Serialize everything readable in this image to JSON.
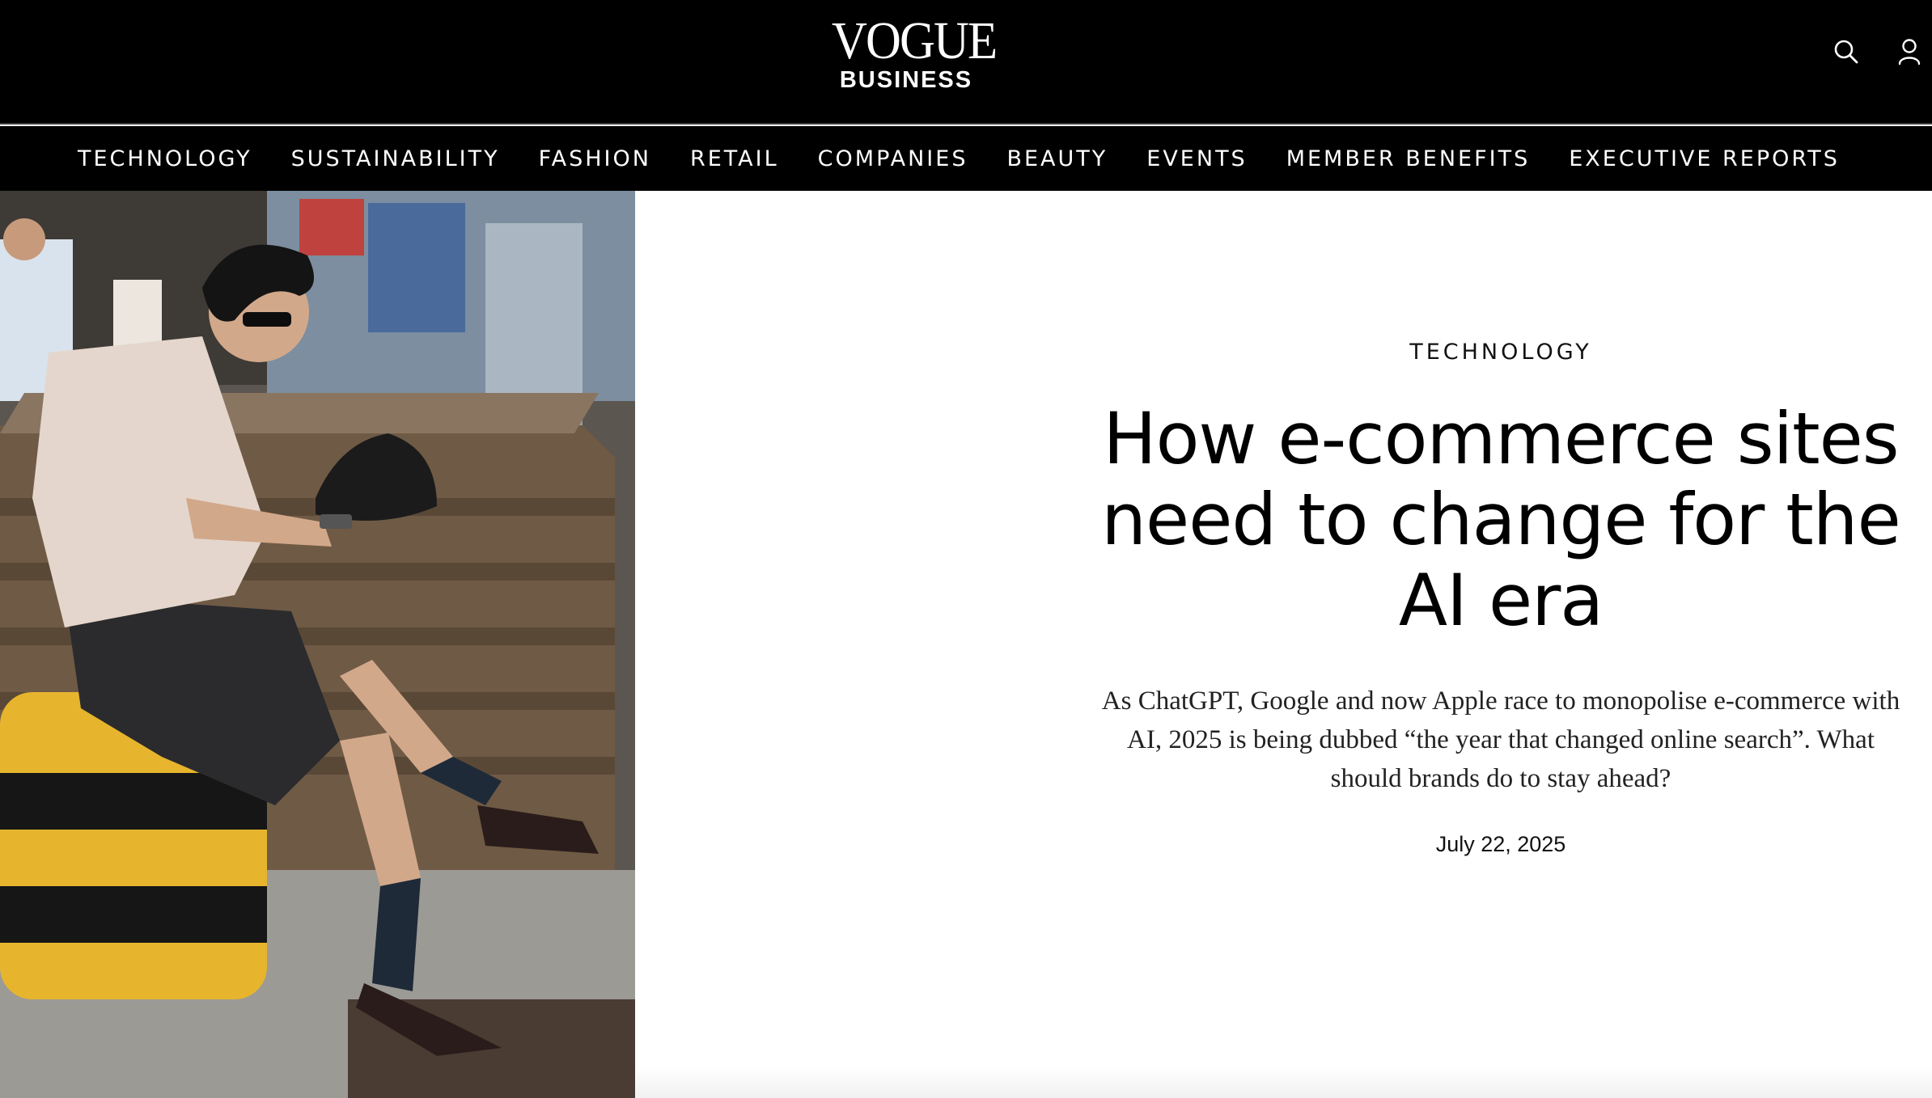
{
  "header": {
    "logo_main": "VOGUE",
    "logo_sub": "BUSINESS",
    "icons": {
      "search": "search-icon",
      "account": "user-icon"
    }
  },
  "nav": {
    "items": [
      {
        "label": "TECHNOLOGY"
      },
      {
        "label": "SUSTAINABILITY"
      },
      {
        "label": "FASHION"
      },
      {
        "label": "RETAIL"
      },
      {
        "label": "COMPANIES"
      },
      {
        "label": "BEAUTY"
      },
      {
        "label": "EVENTS"
      },
      {
        "label": "MEMBER BENEFITS"
      },
      {
        "label": "EXECUTIVE REPORTS"
      }
    ]
  },
  "article": {
    "category": "TECHNOLOGY",
    "headline": "How e-commerce sites need to change for the AI era",
    "dek": "As ChatGPT, Google and now Apple race to monopolise e-commerce with AI, 2025 is being dubbed “the year that changed online search”. What should brands do to stay ahead?",
    "date": "July 22, 2025"
  },
  "colors": {
    "header_bg": "#000000",
    "header_text": "#ffffff",
    "page_bg": "#ffffff",
    "text": "#000000"
  }
}
